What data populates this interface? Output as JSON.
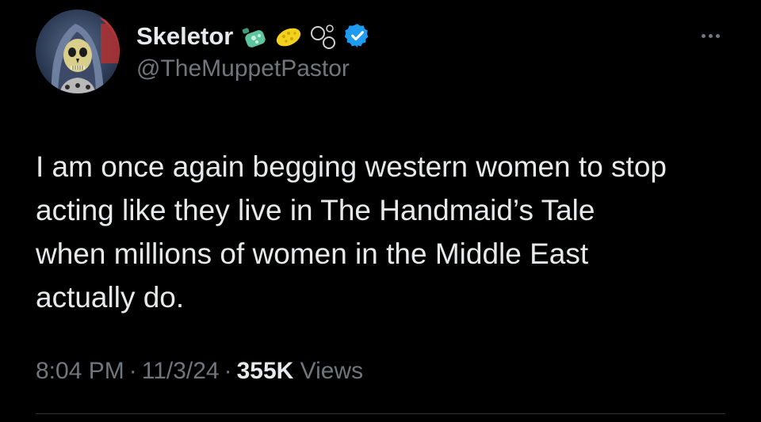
{
  "author": {
    "display_name": "Skeletor",
    "handle": "@TheMuppetPastor",
    "verified": true,
    "badge_icons": [
      "lotion-bottle-icon",
      "sponge-icon",
      "bubbles-icon",
      "verified-badge-icon"
    ]
  },
  "tweet": {
    "lines": [
      "I am once again begging western women to stop",
      "acting like they live in The Handmaid’s Tale",
      "when millions of women in the Middle East",
      "actually do."
    ]
  },
  "meta": {
    "time": "8:04 PM",
    "separator": "·",
    "date": "11/3/24",
    "views_count": "355K",
    "views_label": "Views"
  },
  "colors": {
    "background": "#000000",
    "text": "#e7e9ea",
    "secondary": "#71767b",
    "verified_blue": "#1d9bf0",
    "divider": "#2f3336"
  }
}
